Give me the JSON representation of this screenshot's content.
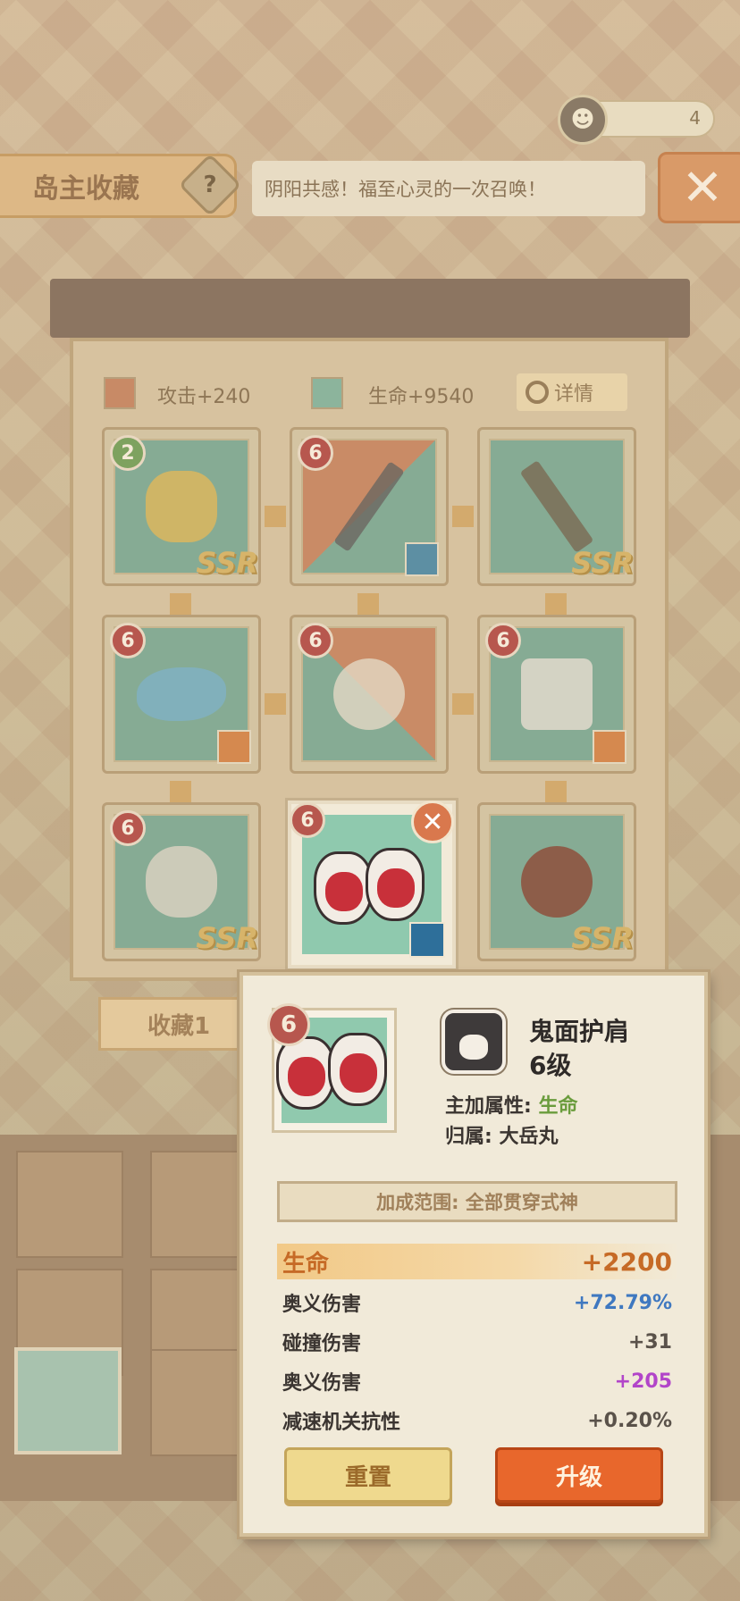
{
  "currency": {
    "value": "4"
  },
  "header": {
    "title": "岛主收藏",
    "help": "?",
    "banner": "阴阳共感！福至心灵的一次召唤！",
    "close": "✕"
  },
  "board": {
    "stat_atk": "攻击+240",
    "stat_hp": "生命+9540",
    "detail_label": "详情",
    "slots": [
      {
        "level": "2",
        "ssr": "SSR"
      },
      {
        "level": "6"
      },
      {
        "level": "",
        "ssr": "SSR"
      },
      {
        "level": "6"
      },
      {
        "level": "6"
      },
      {
        "level": "6"
      },
      {
        "level": "6",
        "ssr": "SSR"
      },
      {
        "level": "",
        "ssr": "SSR"
      }
    ],
    "selected": {
      "level": "6",
      "close": "✕"
    },
    "collection_tab": "收藏1"
  },
  "popup": {
    "level": "6",
    "name": "鬼面护肩",
    "grade": "6级",
    "main_attr_label": "主加属性:",
    "main_attr_value": "生命",
    "owner_label": "归属:",
    "owner_value": "大岳丸",
    "range": "加成范围: 全部贯穿式神",
    "stats": [
      {
        "label": "生命",
        "value": "+2200"
      },
      {
        "label": "奥义伤害",
        "value": "+72.79%"
      },
      {
        "label": "碰撞伤害",
        "value": "+31"
      },
      {
        "label": "奥义伤害",
        "value": "+205"
      },
      {
        "label": "减速机关抗性",
        "value": "+0.20%"
      }
    ],
    "reset_label": "重置",
    "upgrade_label": "升级"
  },
  "colors": {
    "accent_orange": "#e8672c",
    "main_stat": "#c66a26",
    "blue_stat": "#3f78c0",
    "purple_stat": "#b245c9",
    "green_attr": "#6a9c3c"
  }
}
